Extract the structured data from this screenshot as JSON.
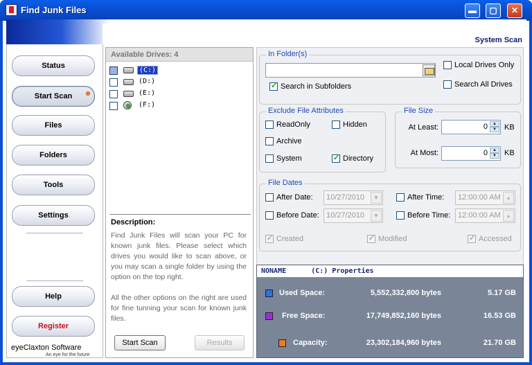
{
  "window": {
    "title": "Find Junk Files",
    "buttons": {
      "minimize": "▬",
      "maximize": "▢",
      "close": "✕"
    }
  },
  "header": {
    "section": "System Scan"
  },
  "nav": {
    "items": [
      "Status",
      "Start Scan",
      "Files",
      "Folders",
      "Tools",
      "Settings"
    ],
    "help": "Help",
    "register": "Register",
    "brand": "eyeClaxton Software",
    "tagline": "An eye for the future"
  },
  "drives": {
    "header": "Available Drives: 4",
    "list": [
      {
        "label": "(C:)",
        "checked": false,
        "selected": true
      },
      {
        "label": "(D:)",
        "checked": false
      },
      {
        "label": "(E:)",
        "checked": false
      },
      {
        "label": "(F:)",
        "checked": false
      }
    ],
    "description_title": "Description:",
    "description_p1": "Find Junk Files will scan your PC for known junk files. Please select which drives you would like to scan above, or you may scan a single folder by using the option on the top right.",
    "description_p2": "All the other options on the right are used for fine tunning your scan for known junk files.",
    "start_scan": "Start Scan",
    "results": "Results"
  },
  "in_folder": {
    "label": "In Folder(s)",
    "path_value": "",
    "search_subfolders": "Search in Subfolders",
    "local_drives_only": "Local Drives Only",
    "search_all_drives": "Search All Drives"
  },
  "exclude": {
    "label": "Exclude File Attributes",
    "readonly": "ReadOnly",
    "hidden": "Hidden",
    "archive": "Archive",
    "system": "System",
    "directory": "Directory"
  },
  "file_size": {
    "label": "File Size",
    "at_least_label": "At Least:",
    "at_least_value": "0",
    "at_most_label": "At Most:",
    "at_most_value": "0",
    "unit": "KB"
  },
  "file_dates": {
    "label": "File Dates",
    "after_date": "After Date:",
    "after_date_value": "10/27/2010",
    "before_date": "Before Date:",
    "before_date_value": "10/27/2010",
    "after_time": "After Time:",
    "after_time_value": "12:00:00 AM",
    "before_time": "Before Time:",
    "before_time_value": "12:00:00 AM",
    "created": "Created",
    "modified": "Modified",
    "accessed": "Accessed"
  },
  "properties": {
    "title": "NONAME      (C:) Properties",
    "used_label": "Used Space:",
    "used_bytes": "5,552,332,800 bytes",
    "used_gb": "5.17 GB",
    "free_label": "Free Space:",
    "free_bytes": "17,749,852,160 bytes",
    "free_gb": "16.53 GB",
    "capacity_label": "Capacity:",
    "capacity_bytes": "23,302,184,960 bytes",
    "capacity_gb": "21.70 GB",
    "colors": {
      "used": "#2f6fe0",
      "free": "#9b2fd6",
      "capacity": "#f07a18"
    }
  }
}
